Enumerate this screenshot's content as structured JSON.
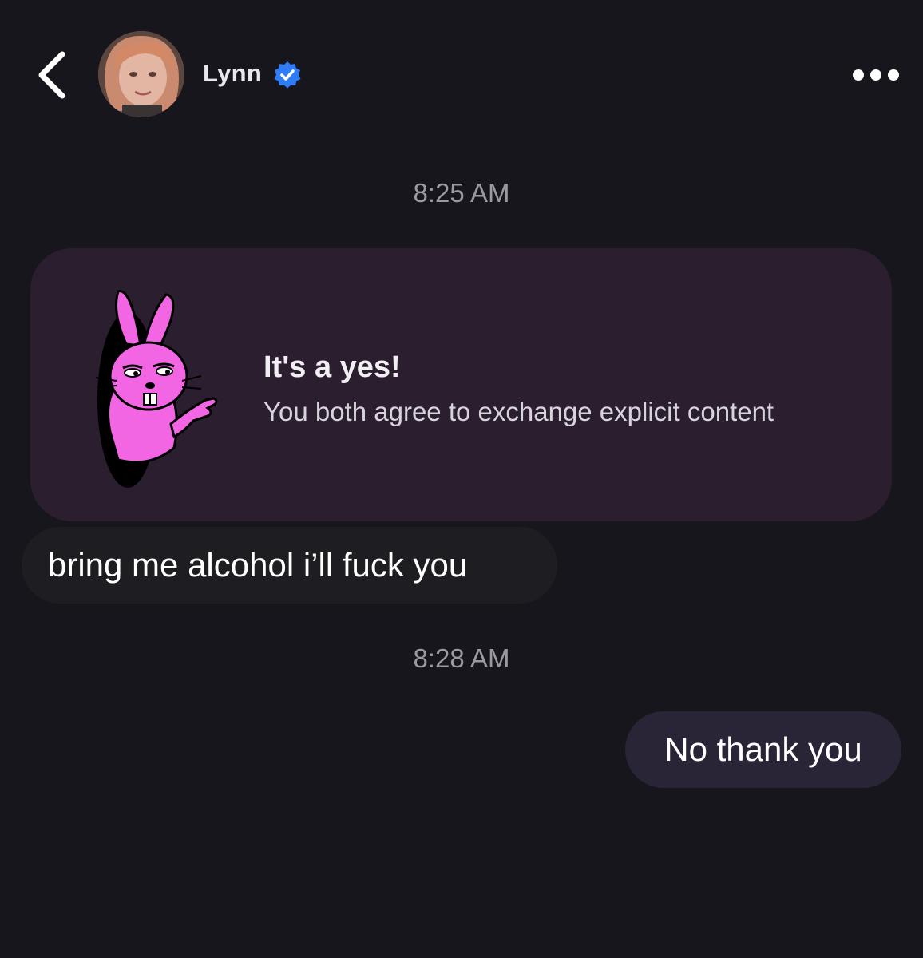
{
  "header": {
    "contact_name": "Lynn",
    "verified": true,
    "icons": {
      "back": "chevron-left-icon",
      "verified": "verified-badge-icon",
      "more": "more-horizontal-icon"
    }
  },
  "conversation": {
    "timestamps": [
      "8:25 AM",
      "8:28 AM"
    ],
    "consent_card": {
      "title": "It's a yes!",
      "subtitle": "You both agree to exchange explicit content",
      "illustration": "pink-bunny-illustration"
    },
    "messages": [
      {
        "direction": "incoming",
        "text": "bring me alcohol i’ll fuck you"
      },
      {
        "direction": "outgoing",
        "text": "No thank you"
      }
    ]
  },
  "colors": {
    "background": "#17161c",
    "card": "#2b1f2f",
    "incoming_bubble": "#1e1e22",
    "outgoing_bubble": "#2a2437",
    "verified_blue": "#2f7cf6",
    "bunny_pink": "#f266e4"
  }
}
